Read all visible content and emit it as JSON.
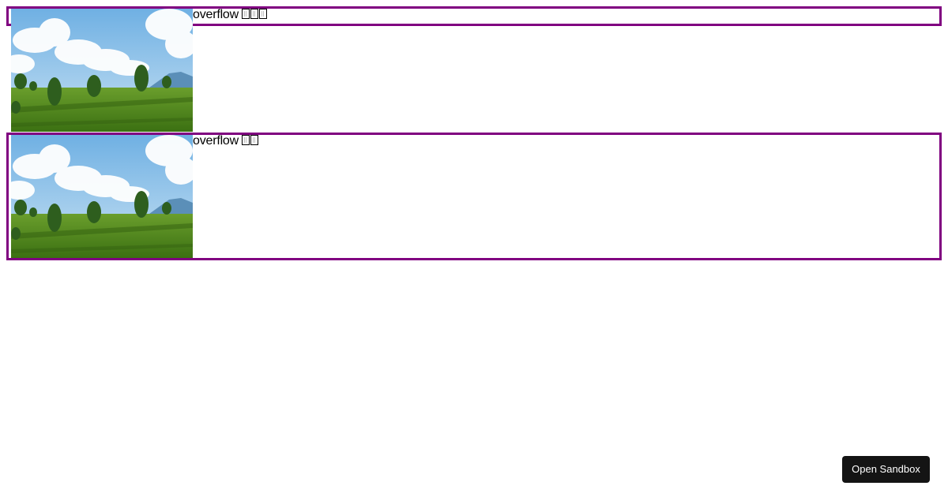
{
  "boxes": [
    {
      "text": "overflow",
      "glyph_count": 3,
      "border_color": "#800080",
      "image": "landscape-image"
    },
    {
      "text": "overflow",
      "glyph_count": 2,
      "border_color": "#800080",
      "image": "landscape-image"
    }
  ],
  "sandbox": {
    "label": "Open Sandbox"
  },
  "colors": {
    "box_border": "#800080",
    "button_bg": "#141414",
    "button_text": "#ffffff",
    "sky": "#8fc2ea",
    "grass": "#4f8a1c"
  }
}
